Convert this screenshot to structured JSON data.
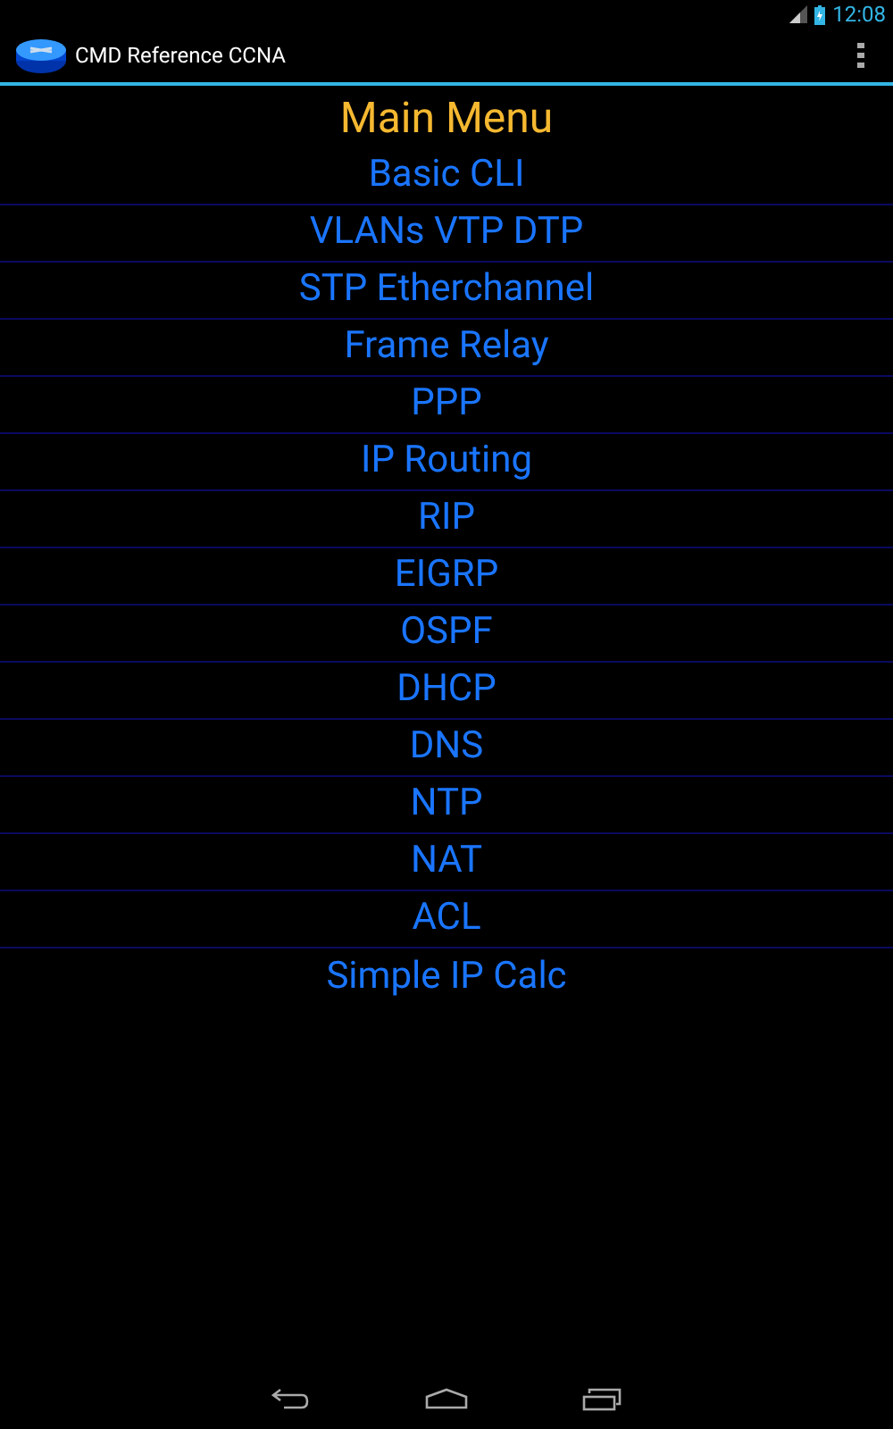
{
  "status_bar": {
    "time": "12:08"
  },
  "action_bar": {
    "title": "CMD Reference CCNA"
  },
  "heading": "Main Menu",
  "menu_items": [
    "Basic CLI",
    "VLANs VTP DTP",
    "STP Etherchannel",
    "Frame Relay",
    "PPP",
    "IP Routing",
    "RIP",
    "EIGRP",
    "OSPF",
    "DHCP",
    "DNS",
    "NTP",
    "NAT",
    "ACL",
    "Simple IP Calc"
  ]
}
